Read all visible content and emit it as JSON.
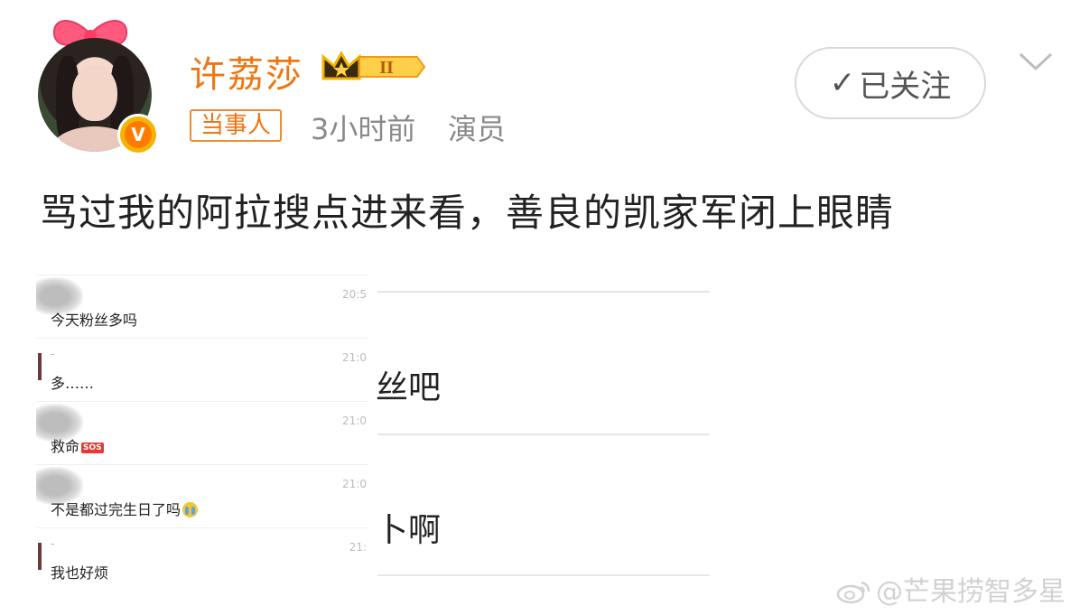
{
  "user": {
    "name": "许荔莎",
    "vip_badge": "II",
    "tag": "当事人",
    "time": "3小时前",
    "role": "演员",
    "follow_label": "已关注",
    "avatar_icon": "avatar-photo",
    "verify_badge": "V"
  },
  "post": {
    "text": "骂过我的阿拉搜点进来看，善良的凯家军闭上眼睛"
  },
  "chat_screenshot": {
    "rows": [
      {
        "time": "20:5",
        "sender": "",
        "message": "今天粉丝多吗",
        "emoji": ""
      },
      {
        "time": "21:0",
        "sender": "-",
        "message": "多……",
        "emoji": ""
      },
      {
        "time": "21:0",
        "sender": "",
        "message": "救命",
        "emoji": "SOS"
      },
      {
        "time": "21:0",
        "sender": "",
        "message": "不是都过完生日了吗",
        "emoji": "crying-face"
      },
      {
        "time": "21:",
        "sender": "-",
        "message": "我也好烦",
        "emoji": ""
      }
    ],
    "background_fragments": [
      "丝吧",
      "卜啊"
    ]
  },
  "watermark": {
    "text": "@芒果捞智多星"
  },
  "colors": {
    "username": "#f0750f",
    "meta": "#8a8a8a",
    "verify": "#f6b300",
    "border": "#d9d9d9"
  }
}
